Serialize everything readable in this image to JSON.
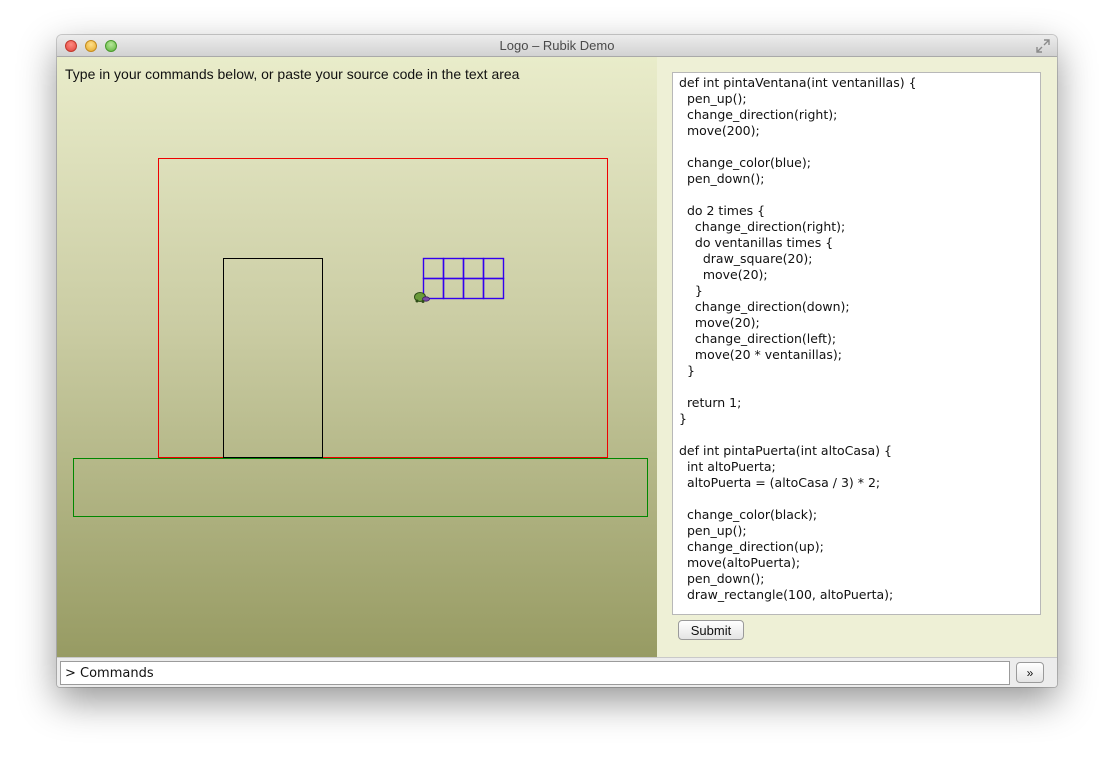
{
  "window": {
    "title": "Logo – Rubik Demo"
  },
  "canvas": {
    "instruction": "Type in your commands below, or paste your source code in the text area",
    "colors": {
      "house": "#ee0000",
      "ground": "#008800",
      "door": "#000000",
      "window": "#3300ee"
    }
  },
  "editor": {
    "code": "def int pintaVentana(int ventanillas) {\n  pen_up();\n  change_direction(right);\n  move(200);\n\n  change_color(blue);\n  pen_down();\n\n  do 2 times {\n    change_direction(right);\n    do ventanillas times {\n      draw_square(20);\n      move(20);\n    }\n    change_direction(down);\n    move(20);\n    change_direction(left);\n    move(20 * ventanillas);\n  }\n\n  return 1;\n}\n\ndef int pintaPuerta(int altoCasa) {\n  int altoPuerta;\n  altoPuerta = (altoCasa / 3) * 2;\n\n  change_color(black);\n  pen_up();\n  change_direction(up);\n  move(altoPuerta);\n  pen_down();\n  draw_rectangle(100, altoPuerta);",
    "submit_label": "Submit"
  },
  "command_bar": {
    "value": "> Commands",
    "go_label": "»"
  },
  "icons": {
    "close": "close-icon",
    "minimize": "minimize-icon",
    "zoom": "zoom-icon",
    "fullscreen": "fullscreen-icon",
    "turtle": "turtle-icon"
  }
}
